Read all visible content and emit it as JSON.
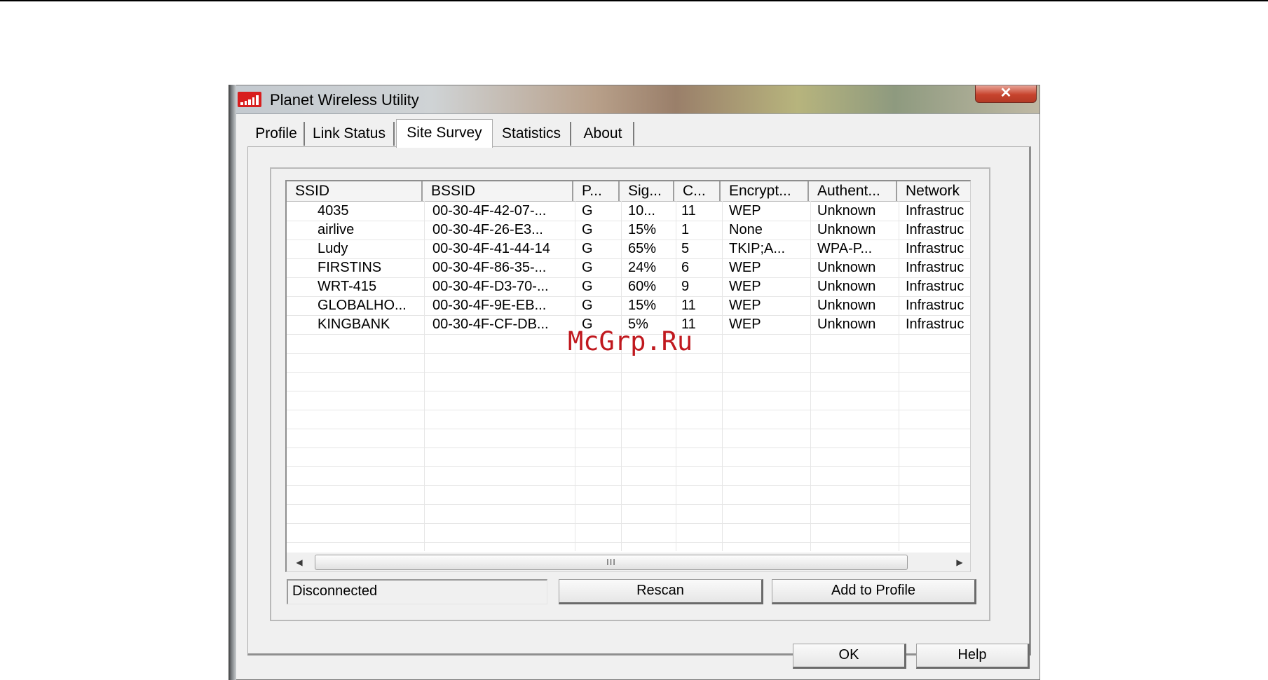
{
  "window": {
    "title": "Planet Wireless Utility",
    "close_glyph": "✕"
  },
  "tabs": [
    {
      "label": "Profile"
    },
    {
      "label": "Link Status"
    },
    {
      "label": "Site Survey"
    },
    {
      "label": "Statistics"
    },
    {
      "label": "About"
    }
  ],
  "active_tab": "Site Survey",
  "table": {
    "columns": [
      "SSID",
      "BSSID",
      "P...",
      "Sig...",
      "C...",
      "Encrypt...",
      "Authent...",
      "Network"
    ],
    "rows": [
      [
        "4035",
        "00-30-4F-42-07-...",
        "G",
        "10...",
        "11",
        "WEP",
        "Unknown",
        "Infrastruc"
      ],
      [
        "airlive",
        "00-30-4F-26-E3...",
        "G",
        "15%",
        "1",
        "None",
        "Unknown",
        "Infrastruc"
      ],
      [
        "Ludy",
        "00-30-4F-41-44-14",
        "G",
        "65%",
        "5",
        "TKIP;A...",
        "WPA-P...",
        "Infrastruc"
      ],
      [
        "FIRSTINS",
        "00-30-4F-86-35-...",
        "G",
        "24%",
        "6",
        "WEP",
        "Unknown",
        "Infrastruc"
      ],
      [
        "WRT-415",
        "00-30-4F-D3-70-...",
        "G",
        "60%",
        "9",
        "WEP",
        "Unknown",
        "Infrastruc"
      ],
      [
        "GLOBALHO...",
        "00-30-4F-9E-EB...",
        "G",
        "15%",
        "11",
        "WEP",
        "Unknown",
        "Infrastruc"
      ],
      [
        "KINGBANK",
        "00-30-4F-CF-DB...",
        "G",
        "5%",
        "11",
        "WEP",
        "Unknown",
        "Infrastruc"
      ]
    ]
  },
  "scrollbar": {
    "grip": "III",
    "left_arrow": "◀",
    "right_arrow": "▶"
  },
  "status": {
    "text": "Disconnected"
  },
  "buttons": {
    "rescan": "Rescan",
    "add_to_profile": "Add to Profile",
    "ok": "OK",
    "help": "Help"
  },
  "watermark": "McGrp.Ru",
  "colors": {
    "titlebar_close": "#c7432d",
    "app_icon": "#d81e1e",
    "watermark": "#c0181e"
  }
}
